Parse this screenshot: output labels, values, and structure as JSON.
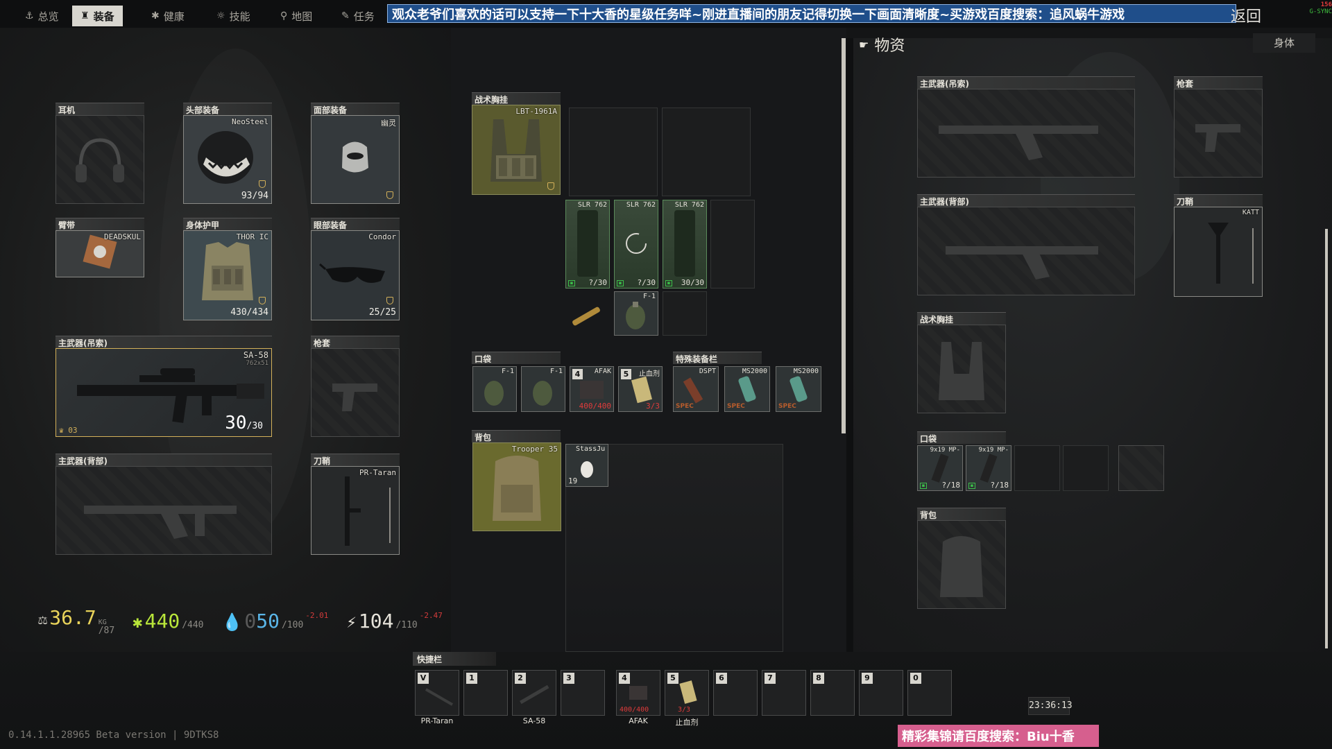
{
  "topbar": {
    "tabs": [
      {
        "label": "总览",
        "icon": "anchor-icon"
      },
      {
        "label": "装备",
        "icon": "gear-person-icon",
        "active": true
      },
      {
        "label": "健康",
        "icon": "health-icon"
      },
      {
        "label": "技能",
        "icon": "skills-icon"
      },
      {
        "label": "地图",
        "icon": "map-pin-icon"
      },
      {
        "label": "任务",
        "icon": "task-icon"
      }
    ],
    "banner_text": "观众老爷们喜欢的话可以支持一下十大香的星级任务咩~刚进直播间的朋友记得切换一下画面清晰度~买游戏百度搜索：追风蜗牛游戏",
    "back_label": "返回",
    "fps_value": "156",
    "sync_label": "G-SYNC"
  },
  "equipment": {
    "headphones": {
      "label": "耳机"
    },
    "headwear": {
      "label": "头部装备",
      "name": "NeoSteel",
      "durability": "93/94"
    },
    "face_cover": {
      "label": "面部装备",
      "name": "幽灵"
    },
    "armband": {
      "label": "臂带",
      "name": "DEADSKUL"
    },
    "body_armor": {
      "label": "身体护甲",
      "name": "THOR IC",
      "durability": "430/434"
    },
    "eyewear": {
      "label": "眼部装备",
      "name": "Condor",
      "durability": "25/25"
    },
    "primary_sling": {
      "label": "主武器(吊索)",
      "name": "SA-58",
      "caliber": "762x51",
      "ammo": "30",
      "ammo_max": "/30",
      "mark": "03"
    },
    "holster": {
      "label": "枪套"
    },
    "primary_back": {
      "label": "主武器(背部)"
    },
    "scabbard": {
      "label": "刀鞘",
      "name": "PR-Taran"
    }
  },
  "rig": {
    "label": "战术胸挂",
    "name": "LBT-1961A",
    "mags": [
      {
        "name": "SLR 762",
        "count": "?/30"
      },
      {
        "name": "SLR 762",
        "count": "?/30"
      },
      {
        "name": "SLR 762",
        "count": "30/30"
      }
    ],
    "grenade": {
      "name": "F-1"
    }
  },
  "pockets": {
    "label": "口袋",
    "items": [
      {
        "name": "F-1"
      },
      {
        "name": "F-1"
      },
      {
        "key": "4",
        "name": "AFAK",
        "count": "400/400"
      },
      {
        "key": "5",
        "name": "止血剂",
        "count": "3/3"
      }
    ]
  },
  "special": {
    "label": "特殊装备栏",
    "items": [
      {
        "name": "DSPT",
        "tag": "SPEC"
      },
      {
        "name": "MS2000",
        "tag": "SPEC"
      },
      {
        "name": "MS2000",
        "tag": "SPEC"
      }
    ]
  },
  "backpack": {
    "label": "背包",
    "name": "Trooper 35",
    "item": {
      "name": "StassJu",
      "count": "19"
    }
  },
  "stats": {
    "weight": "36.7",
    "weight_unit": "KG",
    "weight_max": "/87",
    "health": "440",
    "health_max": "/440",
    "hydration": "50",
    "hydration_prefix": "0",
    "hydration_max": "/100",
    "hydration_delta": "-2.01",
    "energy": "104",
    "energy_max": "/110",
    "energy_delta": "-2.47"
  },
  "quickbar": {
    "label": "快捷栏",
    "slots": [
      {
        "key": "V",
        "label": "PR-Taran"
      },
      {
        "key": "1",
        "label": ""
      },
      {
        "key": "2",
        "label": "SA-58"
      },
      {
        "key": "3",
        "label": ""
      },
      {
        "key": "4",
        "label": "AFAK",
        "count": "400/400"
      },
      {
        "key": "5",
        "label": "止血剂",
        "count": "3/3"
      },
      {
        "key": "6",
        "label": ""
      },
      {
        "key": "7",
        "label": ""
      },
      {
        "key": "8",
        "label": ""
      },
      {
        "key": "9",
        "label": ""
      },
      {
        "key": "0",
        "label": ""
      }
    ]
  },
  "loot": {
    "title": "物资",
    "body_tab": "身体",
    "primary_sling": "主武器(吊索)",
    "holster": "枪套",
    "primary_back": "主武器(背部)",
    "scabbard": "刀鞘",
    "scabbard_name": "KATT",
    "rig": "战术胸挂",
    "pockets": "口袋",
    "pocket_items": [
      {
        "name": "9x19 MP-",
        "count": "?/18"
      },
      {
        "name": "9x19 MP-",
        "count": "?/18"
      }
    ],
    "backpack": "背包"
  },
  "footer": {
    "version": "0.14.1.1.28965 Beta version | 9DTKS8",
    "clock": "23:36:13",
    "ad_text": "精彩集锦请百度搜索：Biu十香"
  },
  "colors": {
    "accent_tab": "#d8d6cf",
    "health_green": "#b9e63a",
    "weight_yellow": "#e9d35a",
    "hydration_blue": "#5ab6e8",
    "warning_red": "#e03b3b",
    "banner_blue": "#1f4e8a"
  }
}
